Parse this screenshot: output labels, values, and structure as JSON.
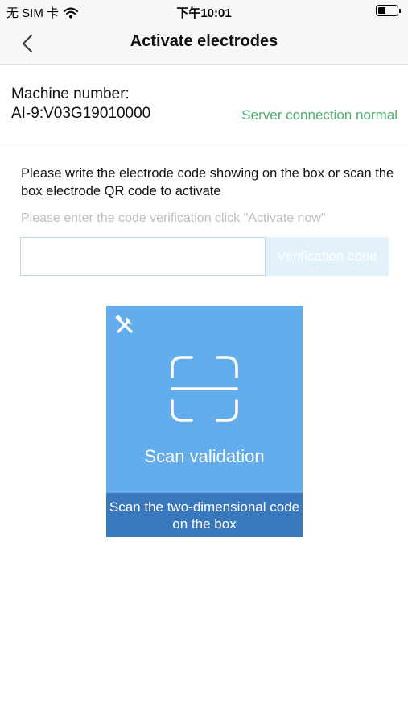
{
  "status_bar": {
    "carrier": "无 SIM 卡",
    "time": "下午10:01",
    "battery_level": 0.45,
    "icons": [
      "wifi-icon",
      "battery-icon"
    ]
  },
  "nav": {
    "title": "Activate electrodes",
    "back_icon": "chevron-left-icon"
  },
  "machine": {
    "label": "Machine number:",
    "number": "AI-9:V03G19010000",
    "server_status": "Server connection normal"
  },
  "activation": {
    "instructions": "Please write the electrode code showing on the box or scan the box electrode QR code to activate",
    "hint": "Please enter the code verification click \"Activate now\"",
    "input_value": "",
    "input_placeholder": "",
    "verify_label": "Verification code"
  },
  "scan": {
    "tools_icon": "tools-icon",
    "scan_icon": "scan-frame-icon",
    "title": "Scan validation",
    "footer": "Scan the two-dimensional code on the box"
  },
  "colors": {
    "status_ok": "#4caf6e",
    "hint_text": "#bdbdbd",
    "verify_button_bg": "#e3f1fb",
    "card_bg": "#63adec",
    "card_footer_bg": "#3a78bd",
    "input_border": "#b8d7ee"
  }
}
